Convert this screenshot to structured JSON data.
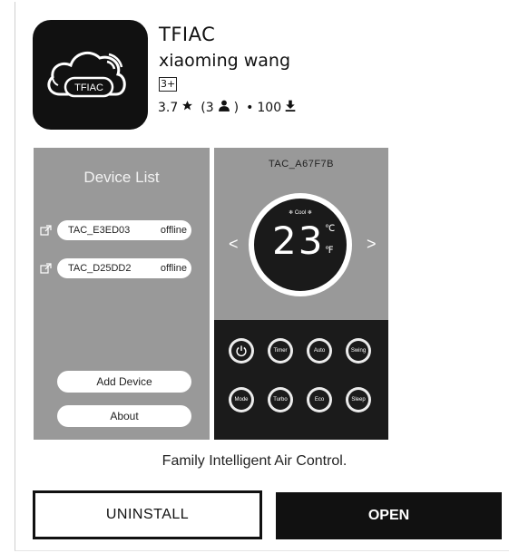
{
  "app": {
    "title": "TFIAC",
    "developer": "xiaoming wang",
    "age_rating": "3+",
    "rating": "3.7",
    "rating_count": "(3",
    "downloads": "100",
    "icon_label": "TFIAC"
  },
  "screenshot_left": {
    "title": "Device List",
    "devices": [
      {
        "name": "TAC_E3ED03",
        "status": "offline"
      },
      {
        "name": "TAC_D25DD2",
        "status": "offline"
      }
    ],
    "add_device": "Add Device",
    "about": "About"
  },
  "screenshot_right": {
    "device_name": "TAC_A67F7B",
    "mode_label": "❄ Cool ❄",
    "temperature": "23",
    "unit_c": "℃",
    "unit_f": "℉",
    "arrow_left": "<",
    "arrow_right": ">",
    "controls": [
      "Timer",
      "Auto",
      "Swing",
      "Mode",
      "Turbo",
      "Eco",
      "Sleep"
    ]
  },
  "tagline": "Family Intelligent Air Control.",
  "buttons": {
    "uninstall": "UNINSTALL",
    "open": "OPEN"
  },
  "icons": [
    "tfiac-cloud-icon",
    "star-icon",
    "person-icon",
    "download-icon",
    "external-link-icon",
    "power-icon"
  ],
  "colors": {
    "dark": "#111111",
    "screenshot_bg": "#999999",
    "panel_bg": "#1b1b1b"
  }
}
